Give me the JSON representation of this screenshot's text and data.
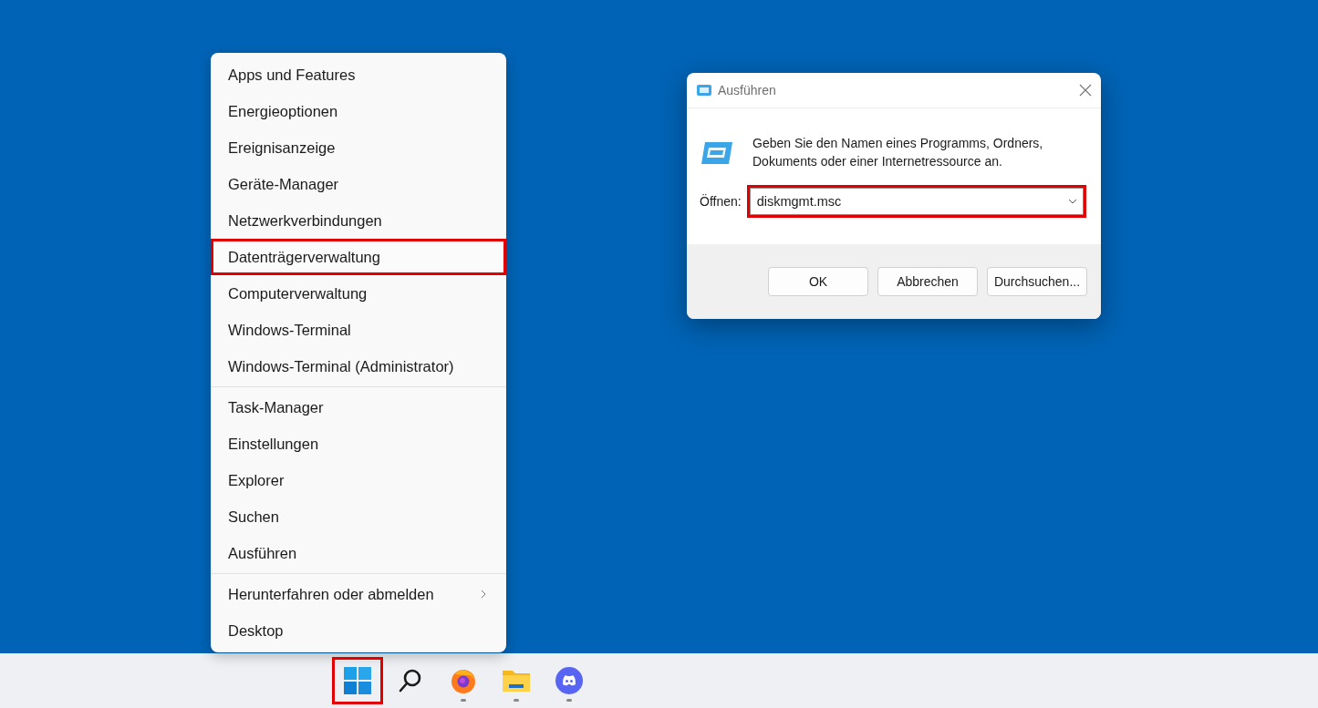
{
  "context_menu": {
    "groups": [
      [
        {
          "label": "Apps und Features",
          "highlighted": false,
          "submenu": false
        },
        {
          "label": "Energieoptionen",
          "highlighted": false,
          "submenu": false
        },
        {
          "label": "Ereignisanzeige",
          "highlighted": false,
          "submenu": false
        },
        {
          "label": "Geräte-Manager",
          "highlighted": false,
          "submenu": false
        },
        {
          "label": "Netzwerkverbindungen",
          "highlighted": false,
          "submenu": false
        },
        {
          "label": "Datenträgerverwaltung",
          "highlighted": true,
          "submenu": false
        },
        {
          "label": "Computerverwaltung",
          "highlighted": false,
          "submenu": false
        },
        {
          "label": "Windows-Terminal",
          "highlighted": false,
          "submenu": false
        },
        {
          "label": "Windows-Terminal (Administrator)",
          "highlighted": false,
          "submenu": false
        }
      ],
      [
        {
          "label": "Task-Manager",
          "highlighted": false,
          "submenu": false
        },
        {
          "label": "Einstellungen",
          "highlighted": false,
          "submenu": false
        },
        {
          "label": "Explorer",
          "highlighted": false,
          "submenu": false
        },
        {
          "label": "Suchen",
          "highlighted": false,
          "submenu": false
        },
        {
          "label": "Ausführen",
          "highlighted": false,
          "submenu": false
        }
      ],
      [
        {
          "label": "Herunterfahren oder abmelden",
          "highlighted": false,
          "submenu": true
        },
        {
          "label": "Desktop",
          "highlighted": false,
          "submenu": false
        }
      ]
    ]
  },
  "run_dialog": {
    "title": "Ausführen",
    "message": "Geben Sie den Namen eines Programms, Ordners, Dokuments oder einer Internetressource an.",
    "field_label": "Öffnen:",
    "value": "diskmgmt.msc",
    "highlighted": true,
    "buttons": [
      "OK",
      "Abbrechen",
      "Durchsuchen..."
    ]
  },
  "taskbar": {
    "items": [
      {
        "kind": "start",
        "highlighted": true,
        "running": false
      },
      {
        "kind": "search",
        "highlighted": false,
        "running": false
      },
      {
        "kind": "firefox",
        "highlighted": false,
        "running": true
      },
      {
        "kind": "folder",
        "highlighted": false,
        "running": true
      },
      {
        "kind": "discord",
        "highlighted": false,
        "running": true
      }
    ]
  }
}
